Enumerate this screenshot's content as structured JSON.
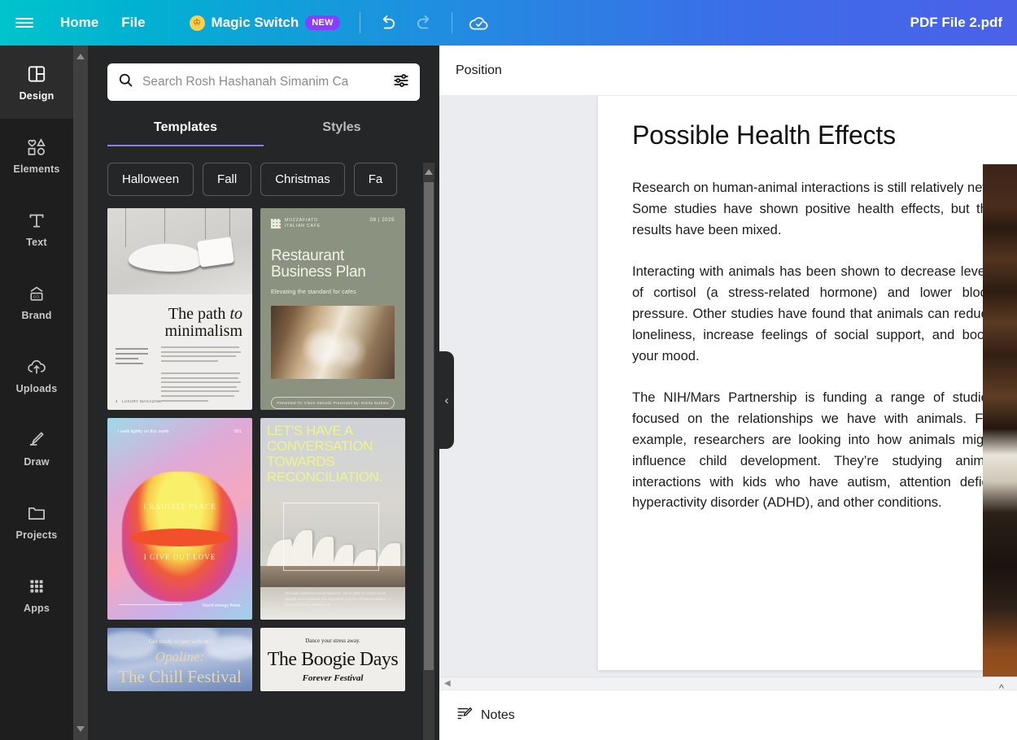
{
  "topbar": {
    "menu_icon": "hamburger-icon",
    "items": [
      {
        "label": "Home",
        "name": "nav-home"
      },
      {
        "label": "File",
        "name": "nav-file"
      }
    ],
    "magic_switch": {
      "label": "Magic Switch",
      "badge": "NEW",
      "crown_icon": "crown-icon"
    },
    "undo_icon": "undo-arrow-icon",
    "redo_icon": "redo-arrow-icon",
    "saved_icon": "cloud-check-icon",
    "doc_title": "PDF File 2.pdf",
    "gradient_from": "#00c4cc",
    "gradient_to": "#4a61e8"
  },
  "rail": {
    "items": [
      {
        "label": "Design",
        "icon": "layout-panels-icon",
        "active": true
      },
      {
        "label": "Elements",
        "icon": "shapes-icon",
        "active": false
      },
      {
        "label": "Text",
        "icon": "text-t-icon",
        "active": false
      },
      {
        "label": "Brand",
        "icon": "brand-card-icon",
        "active": false
      },
      {
        "label": "Uploads",
        "icon": "cloud-upload-icon",
        "active": false
      },
      {
        "label": "Draw",
        "icon": "pen-draw-icon",
        "active": false
      },
      {
        "label": "Projects",
        "icon": "folder-icon",
        "active": false
      },
      {
        "label": "Apps",
        "icon": "grid-dots-icon",
        "active": false
      }
    ]
  },
  "panel": {
    "search": {
      "placeholder": "Search Rosh Hashanah Simanim Ca",
      "value": "",
      "search_icon": "search-icon",
      "filter_icon": "filter-sliders-icon"
    },
    "tabs": [
      {
        "label": "Templates",
        "active": true
      },
      {
        "label": "Styles",
        "active": false
      }
    ],
    "chips": [
      "Halloween",
      "Fall",
      "Christmas",
      "Fa"
    ],
    "chip_next_icon": "chevron-right-icon",
    "accent": "#8b7fe8",
    "templates": [
      {
        "name": "the-path-to-minimalism",
        "title_line1": "The path",
        "title_italic": "to",
        "title_line2": "minimalism",
        "footer": "LUXURY MAGAZINE",
        "page_no": "4"
      },
      {
        "name": "restaurant-business-plan",
        "brand_line1": "MOZZAFIATO",
        "brand_line2": "ITALIAN CAFE",
        "date": "08 | 2025",
        "title": "Restaurant Business Plan",
        "subtitle": "Elevating the standard for cafes",
        "footer": "Presented To: Claire Salcedo      Presented By: Emilia Sorbino"
      },
      {
        "name": "i-radiate-peace-affirmation",
        "top_left": "I walk lightly on this earth.",
        "top_right": "001",
        "line1": "I RADIATE PEACE",
        "line2": "I GIVE OUT LOVE",
        "footer": "Good energy flows."
      },
      {
        "name": "reconciliation-poster",
        "title": "LET'S HAVE A CONVERSATION TOWARDS RECONCILIATION.",
        "caption": "Through informed conversations, we're able to reach more people and continue the important journey of reconciliation — and not just on January 26."
      },
      {
        "name": "opaline-chill-festival",
        "kicker": "Get ready to jam with us!",
        "title_italic": "Opaline:",
        "title": "The Chill Festival"
      },
      {
        "name": "the-boogie-days",
        "kicker": "Dance your stress away.",
        "title": "The Boogie Days",
        "subtitle": "Forever Festival"
      }
    ],
    "collapse_icon": "chevron-left-icon"
  },
  "editor": {
    "position_label": "Position",
    "notes_label": "Notes",
    "notes_icon": "notes-pencil-icon",
    "notes_expand_icon": "chevron-up-icon",
    "hscroll_left_icon": "caret-left-icon",
    "document": {
      "heading": "Possible Health Effects",
      "paragraphs": [
        "Research on human-animal interactions is still relatively new. Some studies have shown positive health effects, but the results have been mixed.",
        "Interacting with animals has been shown to decrease levels of cortisol (a stress-related hormone) and lower blood pressure. Other studies have found that animals can reduce loneliness, increase feelings of social support, and boost your mood.",
        "The NIH/Mars Partnership is funding a range of studies focused on the relationships we have with animals. For example, researchers are looking into how animals might influence child development. They’re studying animal interactions with kids who have autism, attention deficit hyperactivity disorder (ADHD), and other conditions."
      ],
      "side_image_alt": "dog-photo"
    }
  }
}
